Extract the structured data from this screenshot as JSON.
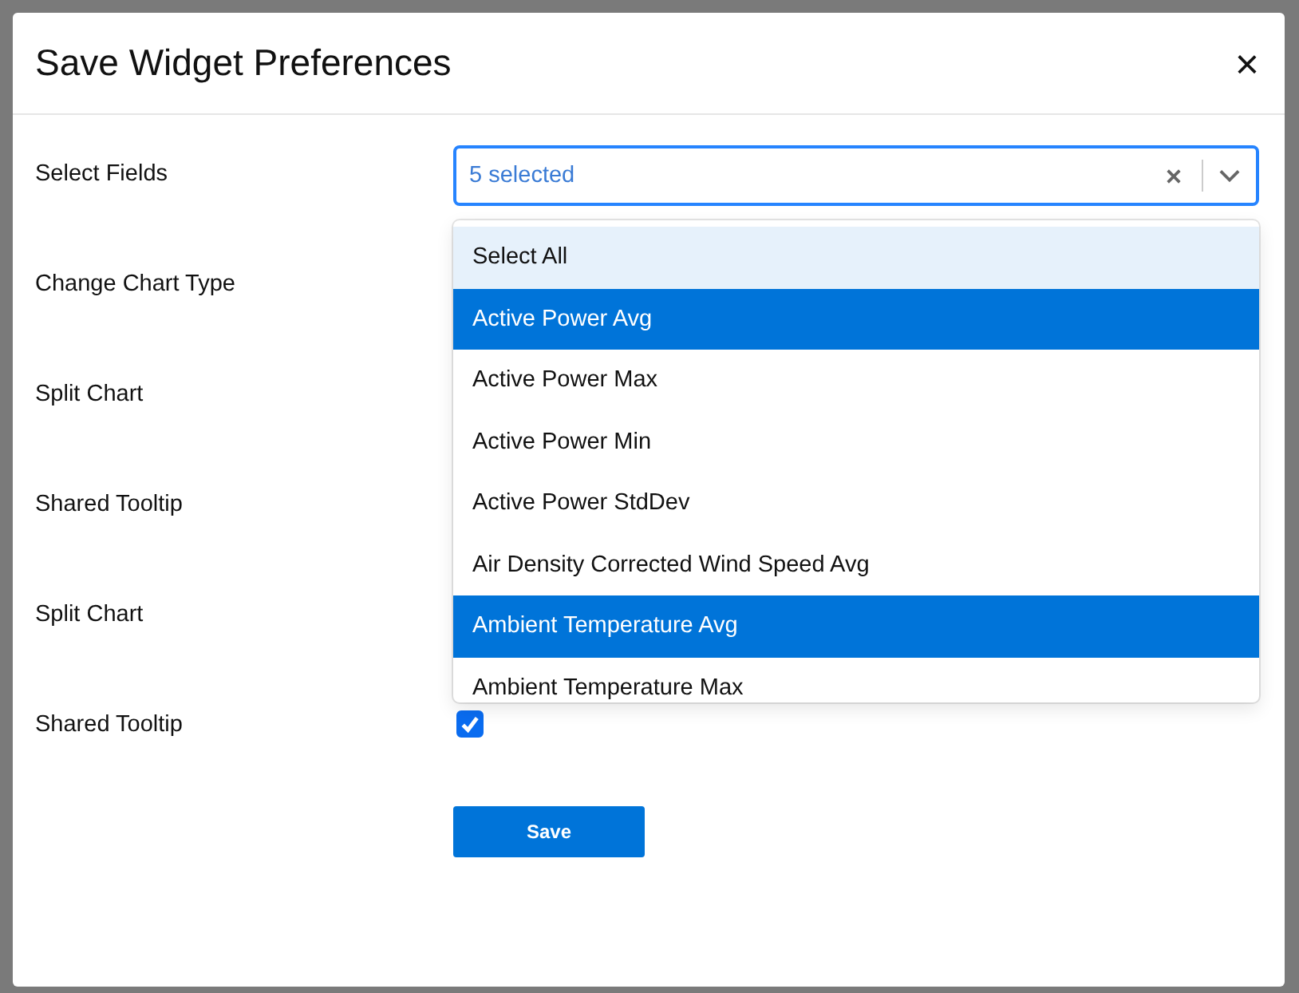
{
  "dialog": {
    "title": "Save Widget Preferences",
    "close": "×"
  },
  "form": [
    {
      "label": "Select Fields",
      "kind": "select",
      "value": "5 selected"
    },
    {
      "label": "Change Chart Type",
      "kind": "covered"
    },
    {
      "label": "Split Chart",
      "kind": "covered"
    },
    {
      "label": "Shared Tooltip",
      "kind": "covered"
    },
    {
      "label": "Split Chart",
      "kind": "covered"
    },
    {
      "label": "Shared Tooltip",
      "kind": "checkbox",
      "checked": true
    }
  ],
  "dropdown": {
    "options": [
      {
        "label": "Select All",
        "selected": false,
        "highlighted": true
      },
      {
        "label": "Active Power Avg",
        "selected": true,
        "highlighted": false
      },
      {
        "label": "Active Power Max",
        "selected": false,
        "highlighted": false
      },
      {
        "label": "Active Power Min",
        "selected": false,
        "highlighted": false
      },
      {
        "label": "Active Power StdDev",
        "selected": false,
        "highlighted": false
      },
      {
        "label": "Air Density Corrected Wind Speed Avg",
        "selected": false,
        "highlighted": false
      },
      {
        "label": "Ambient Temperature Avg",
        "selected": true,
        "highlighted": false
      },
      {
        "label": "Ambient Temperature Max",
        "selected": false,
        "highlighted": false
      }
    ]
  },
  "save_button": "Save"
}
